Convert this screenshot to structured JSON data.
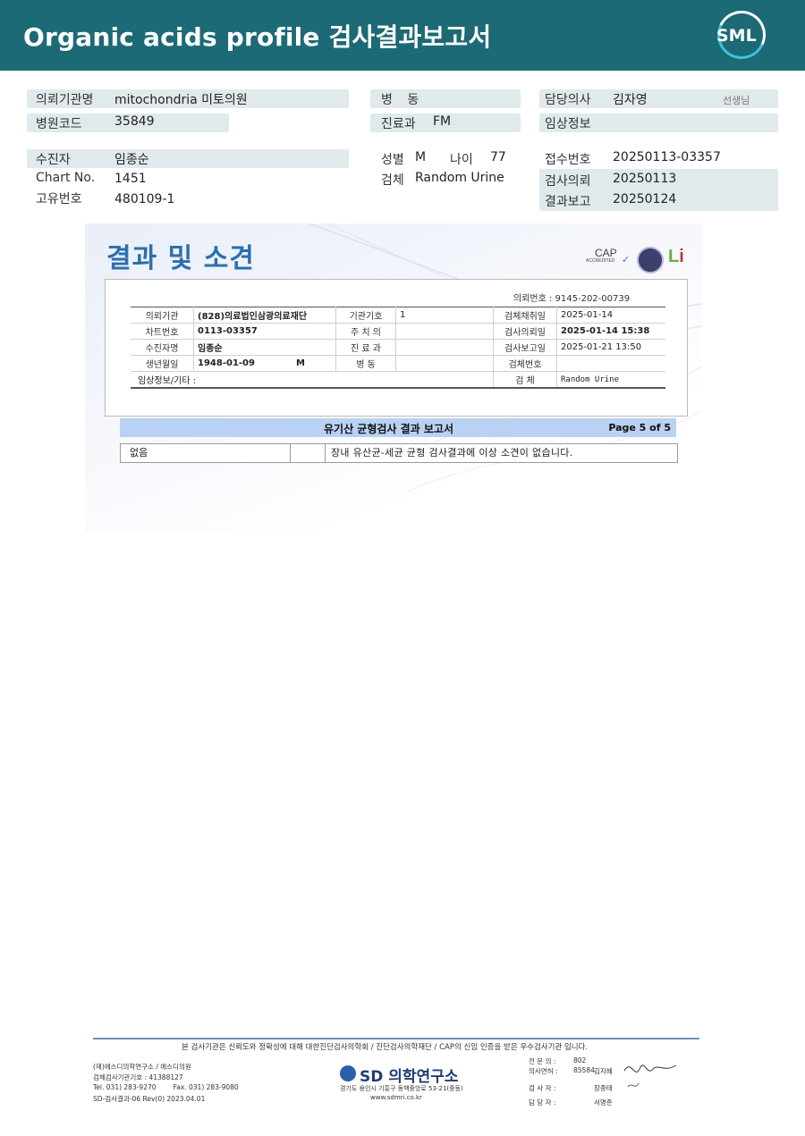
{
  "header": {
    "title": "Organic acids profile 검사결과보고서",
    "logo_text": "SML"
  },
  "info": {
    "requesting_org_label": "의뢰기관명",
    "requesting_org_value": "mitochondria 미토의원",
    "hospital_code_label": "병원코드",
    "hospital_code_value": "35849",
    "patient_label": "수진자",
    "patient_value": "임종순",
    "chart_no_label": "Chart No.",
    "chart_no_value": "1451",
    "unique_no_label": "고유번호",
    "unique_no_value": "480109-1",
    "ward_label": "병 동",
    "department_label": "진료과",
    "department_value": "FM",
    "sex_label": "성별",
    "sex_value": "M",
    "age_label": "나이",
    "age_value": "77",
    "specimen_label": "검체",
    "specimen_value": "Random Urine",
    "doctor_label": "담당의사",
    "doctor_value": "김자영",
    "doctor_suffix": "선생님",
    "clinical_info_label": "임상정보",
    "receipt_no_label": "접수번호",
    "receipt_no_value": "20250113-03357",
    "test_request_label": "검사의뢰",
    "test_request_value": "20250113",
    "result_report_label": "결과보고",
    "result_report_value": "20250124"
  },
  "report": {
    "title": "결과 및 소견",
    "cap_label": "CAP",
    "cap_sub": "ACCREDITED",
    "request_no": "의뢰번호 : 9145-202-00739",
    "rows": [
      [
        "의뢰기관",
        "(828)의료법인삼광의료재단",
        "기관기호",
        "1",
        "검체채취일",
        "2025-01-14"
      ],
      [
        "차트번호",
        "0113-03357",
        "주 치 의",
        "",
        "검사의뢰일",
        "2025-01-14 15:38"
      ],
      [
        "수진자명",
        "임종순",
        "진 료 과",
        "",
        "검사보고일",
        "2025-01-21 13:50"
      ],
      [
        "생년월일",
        "1948-01-09",
        "병    동",
        "",
        "검체번호",
        ""
      ],
      [
        "임상정보/기타 :",
        "",
        "",
        "",
        "검    체",
        "Random Urine"
      ]
    ],
    "birth_sex": "M",
    "banner_title": "유기산 균형검사 결과 보고서",
    "banner_page": "Page 5 of 5",
    "result_col1": "없음",
    "result_col3": "장내 유산균-세균 균형 검사결과에 이상 소견이 없습니다."
  },
  "footer": {
    "notice": "본 검사기관은 신뢰도와 정확성에 대해 대한진단검사의학회 / 진단검사의학재단 / CAP의 신임 인증을 받은 우수검사기관 입니다.",
    "org_line1": "(재)에스디의학연구소 / 에스디의원",
    "org_line2": "검체검사기관기호 : 41388127",
    "org_line3": "Tel. 031) 283-9270        Fax. 031) 283-9080",
    "org_line4": "SD-검사결과-06 Rev(0) 2023.04.01",
    "sd_logo": "SD 의학연구소",
    "address": "경기도 용인시 기흥구 동백중앙로 53-21(중동)",
    "website": "www.sdmri.co.kr",
    "specialist_label": "전 문 의 :",
    "specialist_no": "802",
    "license_label": "의사면허 :",
    "license_no": "85584",
    "license_name": "김지혜",
    "inspector_label": "검 사 자 :",
    "inspector_name": "장종태",
    "manager_label": "담 당 자 :",
    "manager_name": "서명준"
  }
}
